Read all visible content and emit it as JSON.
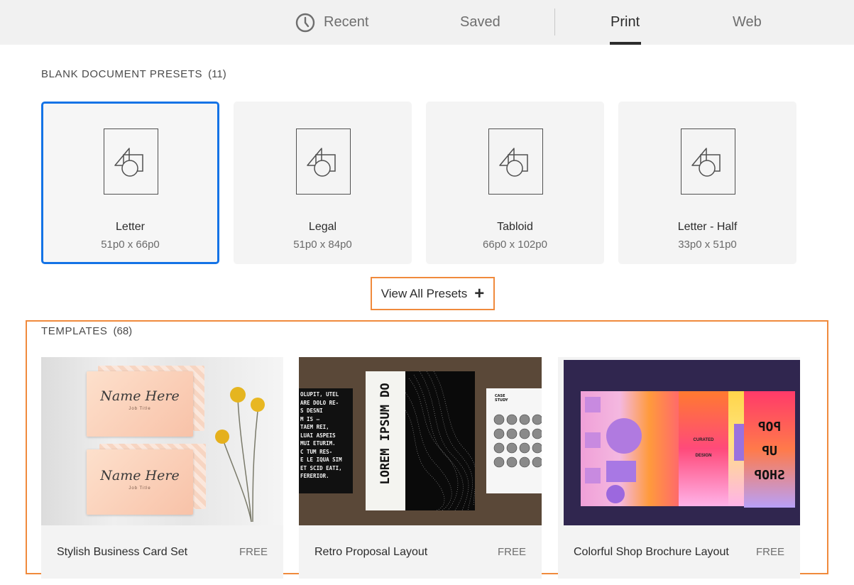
{
  "tabs": {
    "recent": "Recent",
    "saved": "Saved",
    "print": "Print",
    "web": "Web",
    "active": "Print"
  },
  "presets_section": {
    "title": "BLANK DOCUMENT PRESETS",
    "count": "(11)",
    "items": [
      {
        "name": "Letter",
        "size": "51p0 x 66p0",
        "selected": true
      },
      {
        "name": "Legal",
        "size": "51p0 x 84p0",
        "selected": false
      },
      {
        "name": "Tabloid",
        "size": "66p0 x 102p0",
        "selected": false
      },
      {
        "name": "Letter - Half",
        "size": "33p0 x 51p0",
        "selected": false
      }
    ],
    "view_all_label": "View All Presets",
    "view_all_icon": "plus-icon"
  },
  "templates_section": {
    "title": "TEMPLATES",
    "count": "(68)",
    "items": [
      {
        "name": "Stylish Business Card Set",
        "badge": "FREE",
        "thumb_text": {
          "name_here": "Name Here",
          "job_title": "Job Title"
        }
      },
      {
        "name": "Retro Proposal Layout",
        "badge": "FREE",
        "thumb_text": {
          "poster": "LOREM IPSUM DO",
          "body": "OLUPIT, UTEL\nARE DOLO RE-\nS DESNI\nM IS —\nTAEM REI,\nLUAI ASPEIS\nMUI ETURIM.\nC TUM RES-\nE LE IQUA SIM\nET SCID EATI,\nFERERIOR.",
          "case_study": "CASE\nSTUDY"
        }
      },
      {
        "name": "Colorful Shop Brochure Layout",
        "badge": "FREE",
        "thumb_text": {
          "curated": "CURATED",
          "design": "DESIGN",
          "pop_up_shop": "POP UP SHOP"
        }
      }
    ]
  },
  "colors": {
    "accent_selected": "#1473e6",
    "highlight_box": "#f08a3c",
    "topbar_bg": "#f1f1f1"
  }
}
